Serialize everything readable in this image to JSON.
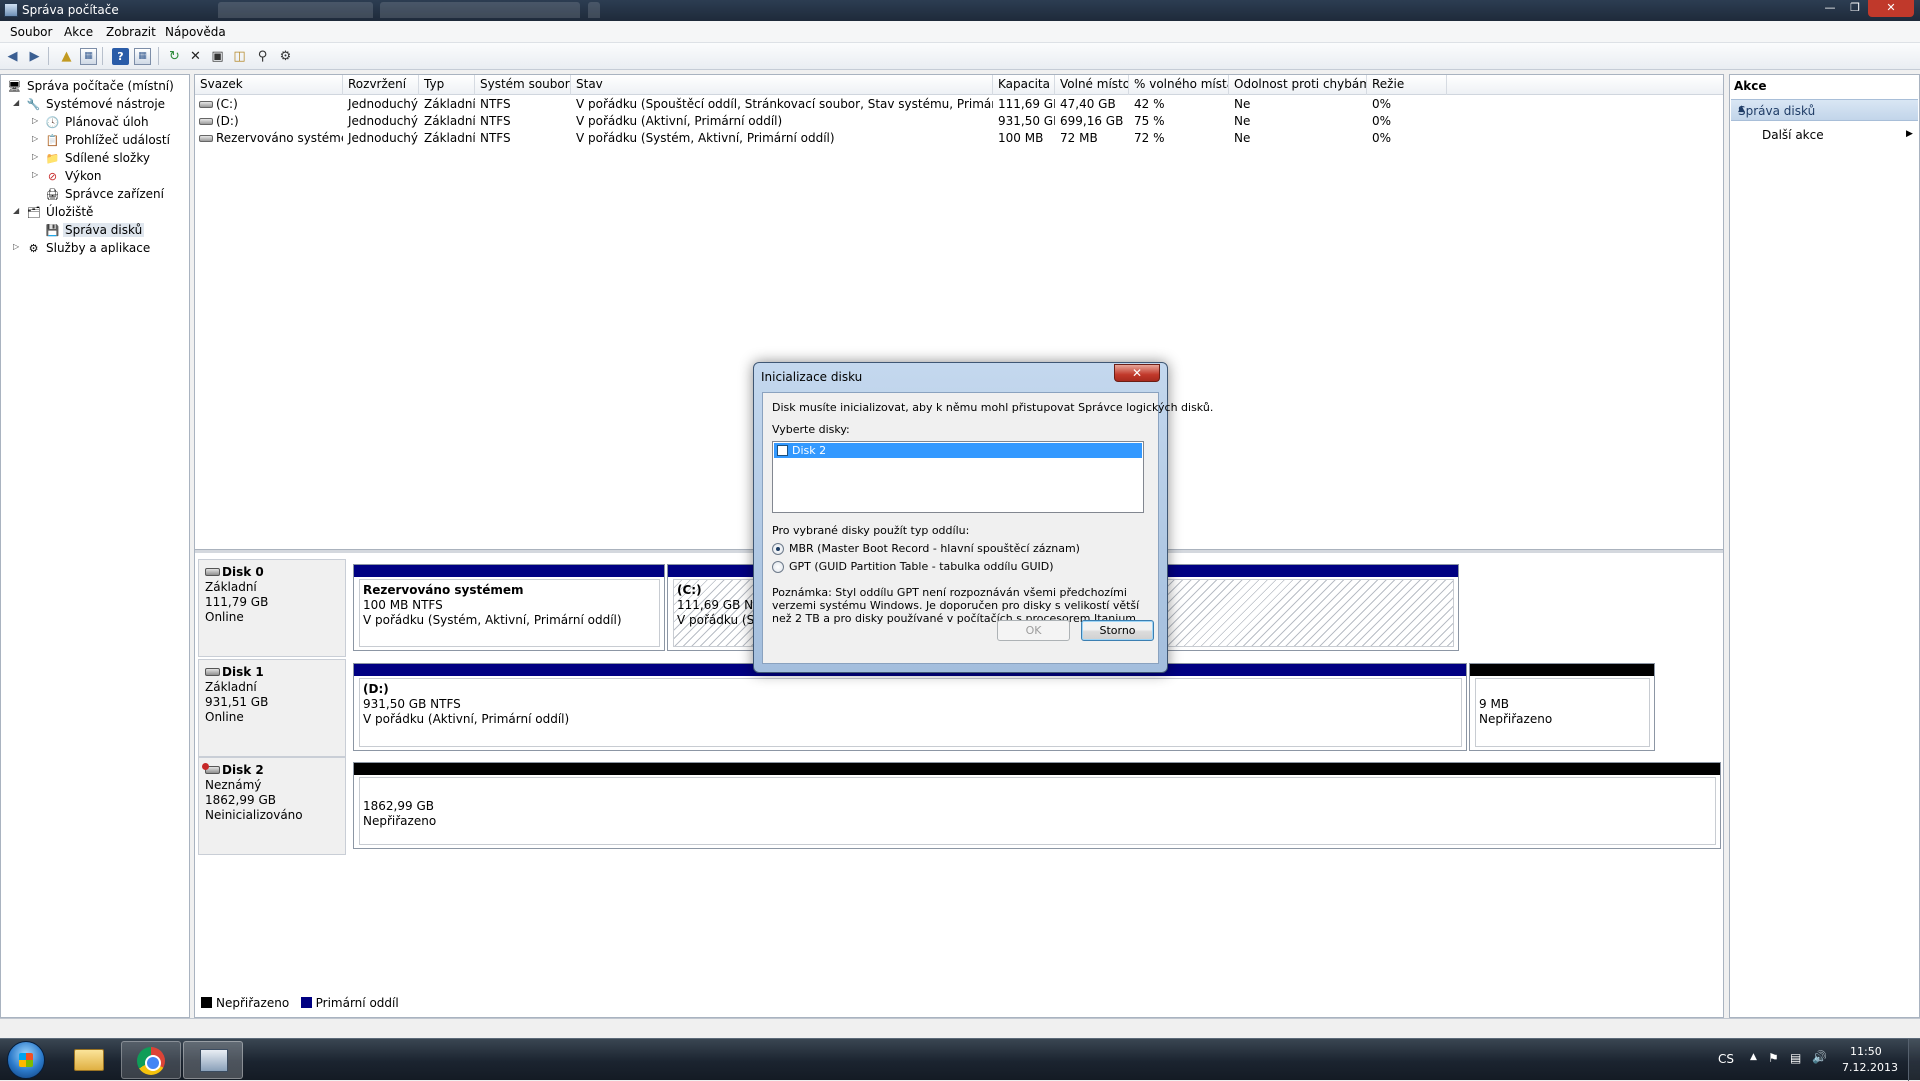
{
  "window": {
    "title": "Správa počítače"
  },
  "menu": [
    "Soubor",
    "Akce",
    "Zobrazit",
    "Nápověda"
  ],
  "tree": {
    "root": "Správa počítače (místní)",
    "system_tools": "Systémové nástroje",
    "task_scheduler": "Plánovač úloh",
    "event_viewer": "Prohlížeč událostí",
    "shared_folders": "Sdílené složky",
    "performance": "Výkon",
    "device_manager": "Správce zařízení",
    "storage": "Úložiště",
    "disk_management": "Správa disků",
    "services_apps": "Služby a aplikace"
  },
  "volume_table": {
    "columns": [
      "Svazek",
      "Rozvržení",
      "Typ",
      "Systém souborů",
      "Stav",
      "Kapacita",
      "Volné místo",
      "% volného místa",
      "Odolnost proti chybám",
      "Režie"
    ],
    "rows": [
      [
        "(C:)",
        "Jednoduchý",
        "Základní",
        "NTFS",
        "V pořádku (Spouštěcí oddíl, Stránkovací soubor, Stav systému, Primární oddíl)",
        "111,69 GB",
        "47,40 GB",
        "42 %",
        "Ne",
        "0%"
      ],
      [
        "(D:)",
        "Jednoduchý",
        "Základní",
        "NTFS",
        "V pořádku (Aktivní, Primární oddíl)",
        "931,50 GB",
        "699,16 GB",
        "75 %",
        "Ne",
        "0%"
      ],
      [
        "Rezervováno systémem",
        "Jednoduchý",
        "Základní",
        "NTFS",
        "V pořádku (Systém, Aktivní, Primární oddíl)",
        "100 MB",
        "72 MB",
        "72 %",
        "Ne",
        "0%"
      ]
    ]
  },
  "disks": {
    "disk0": {
      "name": "Disk 0",
      "type": "Základní",
      "size": "111,79 GB",
      "status": "Online",
      "p1": {
        "name": "Rezervováno systémem",
        "size": "100 MB NTFS",
        "status": "V pořádku (Systém, Aktivní, Primární oddíl)"
      },
      "p2": {
        "name": "(C:)",
        "size": "111,69 GB NTFS",
        "status": "V pořádku (Spo"
      }
    },
    "disk1": {
      "name": "Disk 1",
      "type": "Základní",
      "size": "931,51 GB",
      "status": "Online",
      "p1": {
        "name": "(D:)",
        "size": "931,50 GB NTFS",
        "status": "V pořádku (Aktivní, Primární oddíl)"
      },
      "p2": {
        "size": "9 MB",
        "status": "Nepřiřazeno"
      }
    },
    "disk2": {
      "name": "Disk 2",
      "type": "Neznámý",
      "size": "1862,99 GB",
      "status": "Neinicializováno",
      "p1": {
        "size": "1862,99 GB",
        "status": "Nepřiřazeno"
      }
    }
  },
  "legend": {
    "unallocated": "Nepřiřazeno",
    "unallocated_color": "#000000",
    "primary": "Primární oddíl",
    "primary_color": "#000082"
  },
  "actions": {
    "header": "Akce",
    "section": "Správa disků",
    "more": "Další akce"
  },
  "dialog": {
    "title": "Inicializace disku",
    "intro": "Disk musíte inicializovat, aby k němu mohl přistupovat Správce logických disků.",
    "select_label": "Vyberte disky:",
    "disk_item": "Disk 2",
    "partition_style_label": "Pro vybrané disky použít typ oddílu:",
    "mbr": "MBR (Master Boot Record - hlavní spouštěcí záznam)",
    "gpt": "GPT (GUID Partition Table - tabulka oddílu GUID)",
    "note": "Poznámka: Styl oddílu GPT není rozpoznáván všemi předchozími verzemi systému Windows. Je doporučen pro disky s velikostí větší než 2 TB a pro disky používané v počítačích s procesorem Itanium.",
    "ok": "OK",
    "cancel": "Storno"
  },
  "taskbar": {
    "lang": "CS",
    "time": "11:50",
    "date": "7.12.2013"
  }
}
